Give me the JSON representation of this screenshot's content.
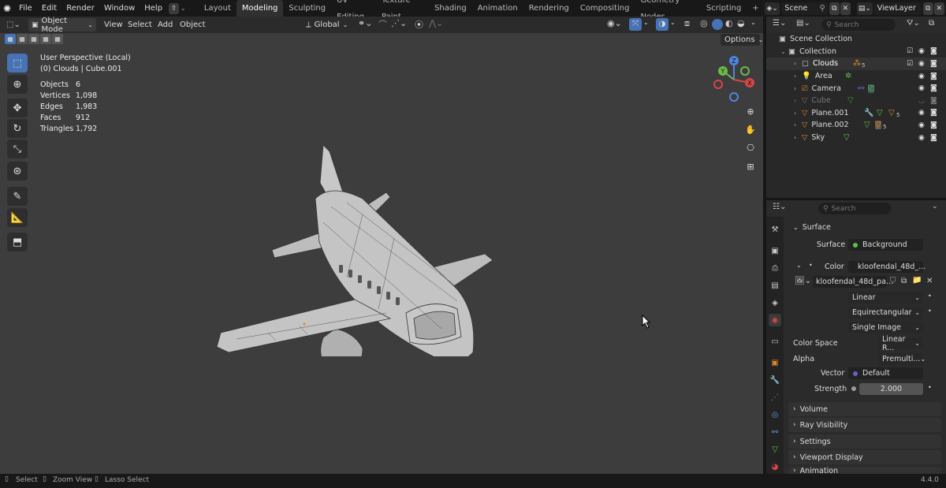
{
  "topbar": {
    "menus": [
      "File",
      "Edit",
      "Render",
      "Window",
      "Help"
    ],
    "workspaces": [
      "Layout",
      "Modeling",
      "Sculpting",
      "UV Editing",
      "Texture Paint",
      "Shading",
      "Animation",
      "Rendering",
      "Compositing",
      "Geometry Nodes",
      "Scripting"
    ],
    "active_workspace": "Modeling",
    "add_tab": "+",
    "scene": "Scene",
    "view_layer": "ViewLayer"
  },
  "viewport_header": {
    "mode": "Object Mode",
    "menus": [
      "View",
      "Select",
      "Add",
      "Object"
    ],
    "orientation": "Global",
    "options": "Options"
  },
  "overlay": {
    "perspective": "User Perspective (Local)",
    "context": "(0) Clouds | Cube.001",
    "stats": [
      {
        "label": "Objects",
        "value": "6"
      },
      {
        "label": "Vertices",
        "value": "1,098"
      },
      {
        "label": "Edges",
        "value": "1,983"
      },
      {
        "label": "Faces",
        "value": "912"
      },
      {
        "label": "Triangles",
        "value": "1,792"
      }
    ]
  },
  "gizmo": {
    "x": "X",
    "y": "Y",
    "z": "Z"
  },
  "outliner": {
    "search_placeholder": "Search",
    "scene_collection": "Scene Collection",
    "collection": "Collection",
    "items": [
      {
        "name": "Clouds",
        "badge": "5"
      },
      {
        "name": "Area",
        "badge": ""
      },
      {
        "name": "Camera",
        "badge": ""
      },
      {
        "name": "Cube",
        "badge": ""
      },
      {
        "name": "Plane.001",
        "badge": "5"
      },
      {
        "name": "Plane.002",
        "badge": "5"
      },
      {
        "name": "Sky",
        "badge": ""
      }
    ]
  },
  "properties": {
    "search_placeholder": "Search",
    "surface_panel": "Surface",
    "surface_label": "Surface",
    "surface_value": "Background",
    "color_label": "Color",
    "color_value": "kloofendal_48d_...",
    "image_name": "kloofendal_48d_pa...",
    "interpolation": "Linear",
    "projection": "Equirectangular",
    "source": "Single Image",
    "color_space_label": "Color Space",
    "color_space_value": "Linear R...",
    "alpha_label": "Alpha",
    "alpha_value": "Premulti...",
    "vector_label": "Vector",
    "vector_value": "Default",
    "strength_label": "Strength",
    "strength_value": "2.000",
    "panels": [
      "Volume",
      "Ray Visibility",
      "Settings",
      "Viewport Display",
      "Animation"
    ]
  },
  "statusbar": {
    "select": "Select",
    "zoom": "Zoom View",
    "lasso": "Lasso Select",
    "version": "4.4.0"
  },
  "colors": {
    "accent": "#4772b3",
    "shader_green": "#5fbf4a",
    "color_yellow": "#c7c72b",
    "vector_purple": "#6363c7",
    "object_orange": "#e0892b"
  }
}
